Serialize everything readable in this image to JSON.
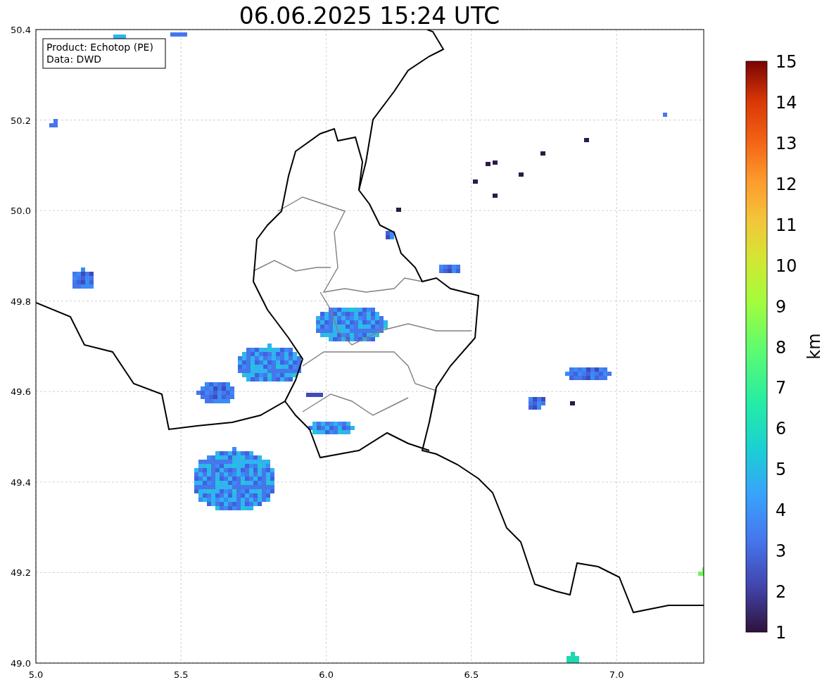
{
  "title": "06.06.2025 15:24 UTC",
  "legend": [
    "Product: Echotop (PE)",
    "Data: DWD"
  ],
  "x_axis": {
    "ticks": [
      "5.0",
      "5.5",
      "6.0",
      "6.5",
      "7.0"
    ]
  },
  "y_axis": {
    "ticks": [
      "50.4",
      "50.2",
      "50.0",
      "49.8",
      "49.6",
      "49.4",
      "49.2",
      "49.0"
    ]
  },
  "colorbar": {
    "label": "km",
    "ticks": [
      "15",
      "14",
      "13",
      "12",
      "11",
      "10",
      "9",
      "8",
      "7",
      "6",
      "5",
      "4",
      "3",
      "2",
      "1"
    ]
  }
}
